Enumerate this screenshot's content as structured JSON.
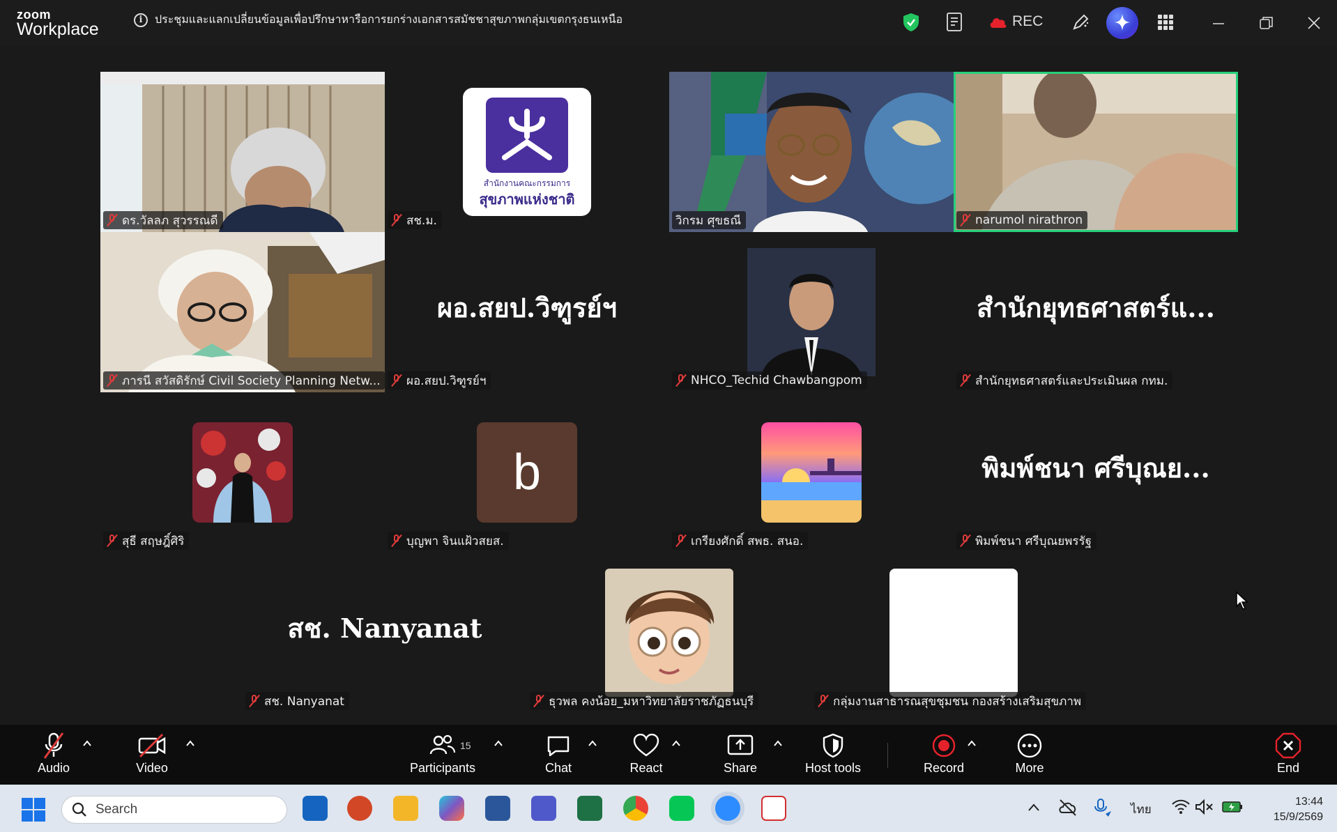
{
  "app": {
    "logo_top": "zoom",
    "logo_bottom": "Workplace",
    "meeting_title": "ประชุมและแลกเปลี่ยนข้อมูลเพื่อปรึกษาหารือการยกร่างเอกสารสมัชชาสุขภาพกลุ่มเขตกรุงธนเหนือ",
    "rec_label": "REC"
  },
  "participants": [
    {
      "name": "ดร.วัลลภ สุวรรณดี",
      "kind": "video"
    },
    {
      "name": "สช.ม.",
      "kind": "logo",
      "logo_text_1": "สำนักงานคณะกรรมการ",
      "logo_text_2": "สุขภาพแห่งชาติ"
    },
    {
      "name": "วิกรม ศุขธณี",
      "kind": "video"
    },
    {
      "name": "narumol nirathron",
      "kind": "video",
      "speaking": true
    },
    {
      "name": "ภารนี สวัสดิรักษ์ Civil Society Planning Netw...",
      "kind": "video"
    },
    {
      "name": "ผอ.สยป.วิฑูรย์ฯ",
      "kind": "name",
      "display": "ผอ.สยป.วิฑูรย์ฯ"
    },
    {
      "name": "NHCO_Techid Chawbangpom",
      "kind": "photo"
    },
    {
      "name": "สำนักยุทธศาสตร์และประเมินผล กทม.",
      "kind": "name",
      "display": "สำนักยุทธศาสตร์แ..."
    },
    {
      "name": "สุธี สฤษฎิ์ศิริ",
      "kind": "photo"
    },
    {
      "name": "บุญพา จินแฝ้วสยส.",
      "kind": "letter",
      "letter": "b"
    },
    {
      "name": "เกรียงศักดิ์ สพธ. สนอ.",
      "kind": "photo"
    },
    {
      "name": "พิมพ์ชนา ศรีบุณยพรรัฐ",
      "kind": "name",
      "display": "พิมพ์ชนา ศรีบุณย..."
    },
    {
      "name": "สช. Nanyanat",
      "kind": "name",
      "display": "สช. Nanyanat"
    },
    {
      "name": "ธุวพล คงน้อย_มหาวิทยาลัยราชภัฏธนบุรี",
      "kind": "photo"
    },
    {
      "name": "กลุ่มงานสาธารณสุขชุมชน กองสร้างเสริมสุขภาพ",
      "kind": "blank"
    }
  ],
  "toolbar": {
    "audio": "Audio",
    "video": "Video",
    "participants": "Participants",
    "participants_count": "15",
    "chat": "Chat",
    "react": "React",
    "share": "Share",
    "host_tools": "Host tools",
    "record": "Record",
    "more": "More",
    "end": "End"
  },
  "taskbar": {
    "search_placeholder": "Search",
    "language": "ไทย",
    "time": "13:44",
    "date": "15/9/2569"
  },
  "colors": {
    "speaking_outline": "#27d07a",
    "muted_red": "#e03b3b",
    "record_red": "#e5222b",
    "shield_green": "#22c55e"
  }
}
